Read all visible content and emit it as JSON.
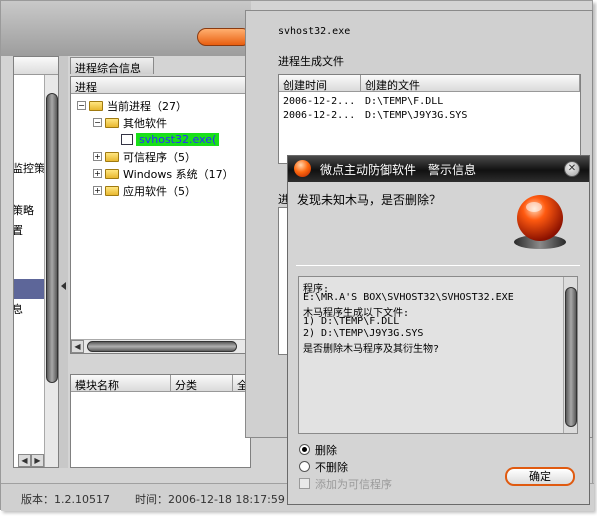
{
  "main_window": {
    "left_nav": {
      "items": [
        "监控策",
        "策略",
        "置",
        "息"
      ]
    },
    "tab_label": "进程综合信息",
    "tree_header": "进程",
    "tree": [
      {
        "label": "当前进程（27）",
        "expanded": true
      },
      {
        "label": "其他软件",
        "expanded": true
      },
      {
        "label": "svhost32.exe(",
        "selected": true
      },
      {
        "label": "可信程序（5）",
        "expanded": false
      },
      {
        "label": "Windows 系统（17）",
        "expanded": false
      },
      {
        "label": "应用软件（5）",
        "expanded": false
      }
    ],
    "module_columns": [
      "模块名称",
      "分类",
      "全"
    ],
    "status": {
      "version": "版本：1.2.10517",
      "time": "时间：2006-12-18 18:17:59"
    }
  },
  "process_window": {
    "process_name": "svhost32.exe",
    "section_label": "进程生成文件",
    "section2_label": "进",
    "columns": [
      "创建时间",
      "创建的文件"
    ],
    "rows": [
      {
        "time": "2006-12-2...",
        "file": "D:\\TEMP\\F.DLL"
      },
      {
        "time": "2006-12-2...",
        "file": "D:\\TEMP\\J9Y3G.SYS"
      }
    ]
  },
  "alert": {
    "title": "微点主动防御软件　警示信息",
    "question": "发现未知木马，是否删除？",
    "message_lines": [
      "程序:",
      "E:\\MR.A'S BOX\\SVHOST32\\SVHOST32.EXE",
      "木马程序生成以下文件:",
      "1) D:\\TEMP\\F.DLL",
      "2) D:\\TEMP\\J9Y3G.SYS",
      "是否删除木马程序及其衍生物?"
    ],
    "options": {
      "delete": "删除",
      "no_delete": "不删除",
      "add_trusted": "添加为可信程序"
    },
    "selected_option": "delete",
    "ok_label": "确定"
  },
  "colors": {
    "selection_green": "#19e019",
    "alert_titlebar": "#111111",
    "accent_orange": "#e05a10"
  }
}
